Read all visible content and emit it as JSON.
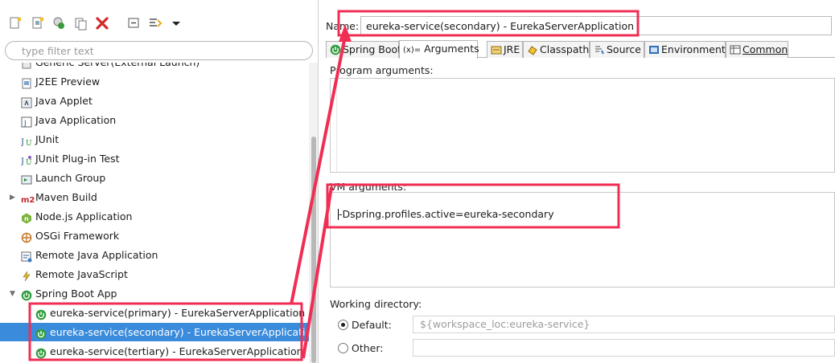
{
  "toolbar": {
    "buttons": [
      "new-config-icon",
      "new-prototype-icon",
      "export-icon",
      "duplicate-icon",
      "delete-icon",
      "collapse-all-icon",
      "filter-icon",
      "view-menu-icon"
    ]
  },
  "filter": {
    "placeholder": "type filter text"
  },
  "tree": {
    "items": [
      {
        "label": "Generic Server(External Launch)",
        "icon": "server-icon"
      },
      {
        "label": "J2EE Preview",
        "icon": "j2ee-icon"
      },
      {
        "label": "Java Applet",
        "icon": "java-applet-icon"
      },
      {
        "label": "Java Application",
        "icon": "java-application-icon"
      },
      {
        "label": "JUnit",
        "icon": "junit-icon"
      },
      {
        "label": "JUnit Plug-in Test",
        "icon": "junit-plugin-icon"
      },
      {
        "label": "Launch Group",
        "icon": "launch-group-icon"
      },
      {
        "label": "Maven Build",
        "icon": "maven-icon",
        "badge": "m2"
      },
      {
        "label": "Node.js Application",
        "icon": "nodejs-icon"
      },
      {
        "label": "OSGi Framework",
        "icon": "osgi-icon"
      },
      {
        "label": "Remote Java Application",
        "icon": "remote-java-icon"
      },
      {
        "label": "Remote JavaScript",
        "icon": "remote-javascript-icon"
      },
      {
        "label": "Spring Boot App",
        "icon": "spring-boot-icon"
      },
      {
        "label": "eureka-service(primary) - EurekaServerApplication",
        "icon": "spring-boot-icon"
      },
      {
        "label": "eureka-service(secondary) - EurekaServerApplication",
        "icon": "spring-boot-icon",
        "selected": true
      },
      {
        "label": "eureka-service(tertiary) - EurekaServerApplication",
        "icon": "spring-boot-icon"
      }
    ]
  },
  "name": {
    "label": "Name:",
    "value": "eureka-service(secondary) - EurekaServerApplication"
  },
  "tabs": [
    {
      "label": "Spring Boot",
      "icon": "spring-boot-icon"
    },
    {
      "label": "Arguments",
      "prefix": "(x)=",
      "icon": "arguments-icon",
      "active": true
    },
    {
      "label": "JRE",
      "icon": "jre-icon"
    },
    {
      "label": "Classpath",
      "icon": "classpath-icon"
    },
    {
      "label": "Source",
      "icon": "source-icon"
    },
    {
      "label": "Environment",
      "icon": "environment-icon"
    },
    {
      "label": "Common",
      "icon": "common-icon"
    }
  ],
  "program_arguments": {
    "label": "Program arguments:",
    "value": ""
  },
  "vm_arguments": {
    "label": "VM arguments:",
    "value": "-Dspring.profiles.active=eureka-secondary"
  },
  "working_directory": {
    "label": "Working directory:",
    "default_label": "Default:",
    "default_value": "${workspace_loc:eureka-service}",
    "other_label": "Other:",
    "other_value": "",
    "selected": "default"
  },
  "colors": {
    "selection": "#3a8bdc",
    "annotation": "#f02e54",
    "spring": "#2f9d3c"
  }
}
